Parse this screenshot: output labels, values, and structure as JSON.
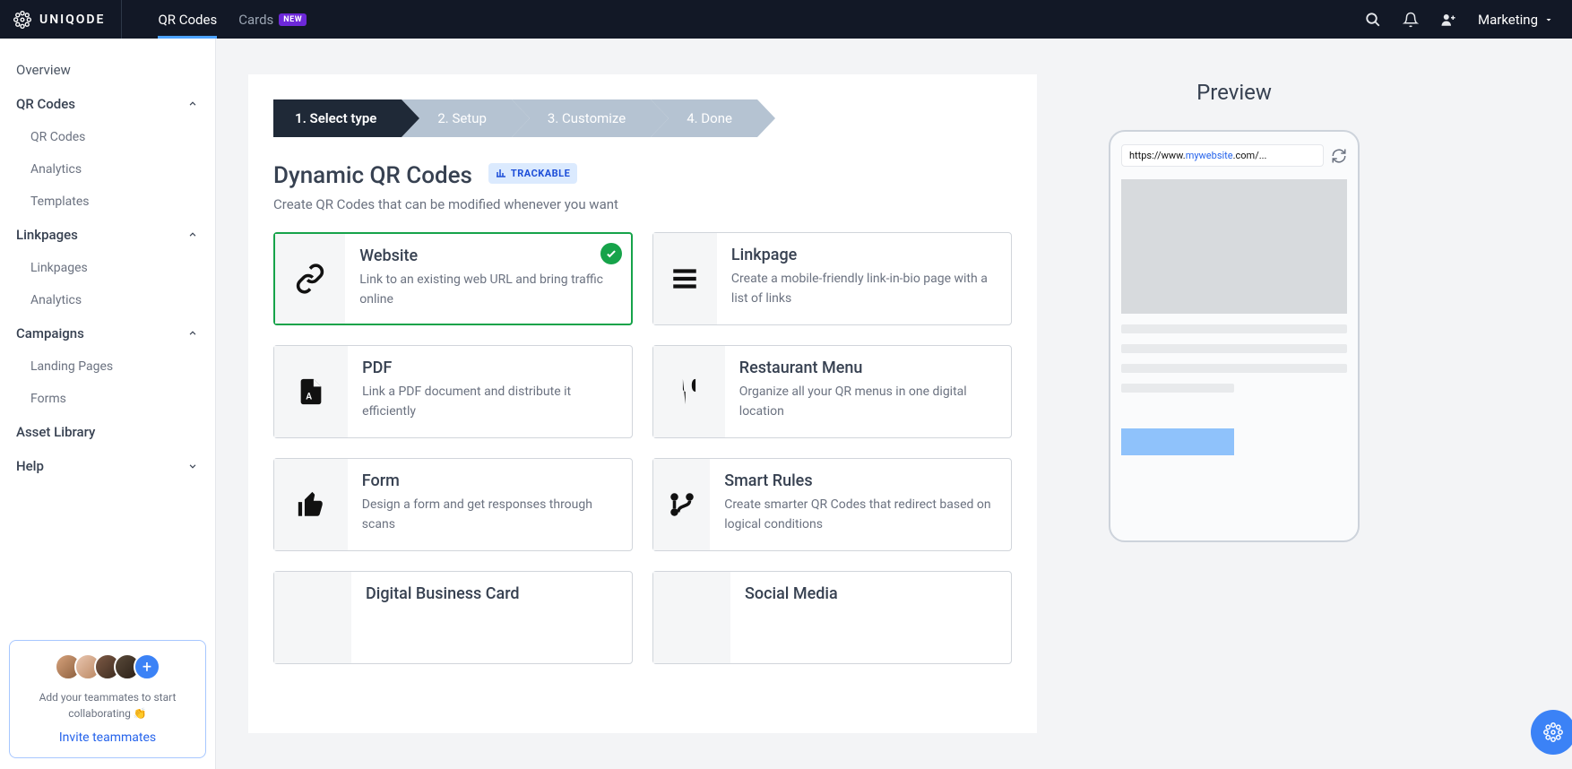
{
  "brand": "UNIQODE",
  "topTabs": [
    {
      "label": "QR Codes",
      "active": true
    },
    {
      "label": "Cards",
      "badge": "NEW"
    }
  ],
  "account": "Marketing",
  "sidebar": {
    "overview": "Overview",
    "groups": [
      {
        "label": "QR Codes",
        "open": true,
        "items": [
          "QR Codes",
          "Analytics",
          "Templates"
        ]
      },
      {
        "label": "Linkpages",
        "open": true,
        "items": [
          "Linkpages",
          "Analytics"
        ]
      },
      {
        "label": "Campaigns",
        "open": true,
        "items": [
          "Landing Pages",
          "Forms"
        ]
      }
    ],
    "assetLibrary": "Asset Library",
    "help": "Help"
  },
  "teamBox": {
    "text": "Add your teammates to start collaborating 👏",
    "invite": "Invite teammates"
  },
  "wizard": [
    "1. Select type",
    "2. Setup",
    "3. Customize",
    "4. Done"
  ],
  "wizardActive": 0,
  "pageTitle": "Dynamic QR Codes",
  "trackable": "TRACKABLE",
  "pageSub": "Create QR Codes that can be modified whenever you want",
  "types": [
    {
      "title": "Website",
      "desc": "Link to an existing web URL and bring traffic online",
      "icon": "link",
      "selected": true
    },
    {
      "title": "Linkpage",
      "desc": "Create a mobile-friendly link-in-bio page with a list of links",
      "icon": "menu"
    },
    {
      "title": "PDF",
      "desc": "Link a PDF document and distribute it efficiently",
      "icon": "pdf"
    },
    {
      "title": "Restaurant Menu",
      "desc": "Organize all your QR menus in one digital location",
      "icon": "food"
    },
    {
      "title": "Form",
      "desc": "Design a form and get responses through scans",
      "icon": "thumb"
    },
    {
      "title": "Smart Rules",
      "desc": "Create smarter QR Codes that redirect based on logical conditions",
      "icon": "branch"
    },
    {
      "title": "Digital Business Card",
      "desc": "",
      "icon": ""
    },
    {
      "title": "Social Media",
      "desc": "",
      "icon": ""
    }
  ],
  "preview": {
    "title": "Preview",
    "url_prefix": "https://www.",
    "url_domain": "mywebsite",
    "url_suffix": ".com/..."
  }
}
